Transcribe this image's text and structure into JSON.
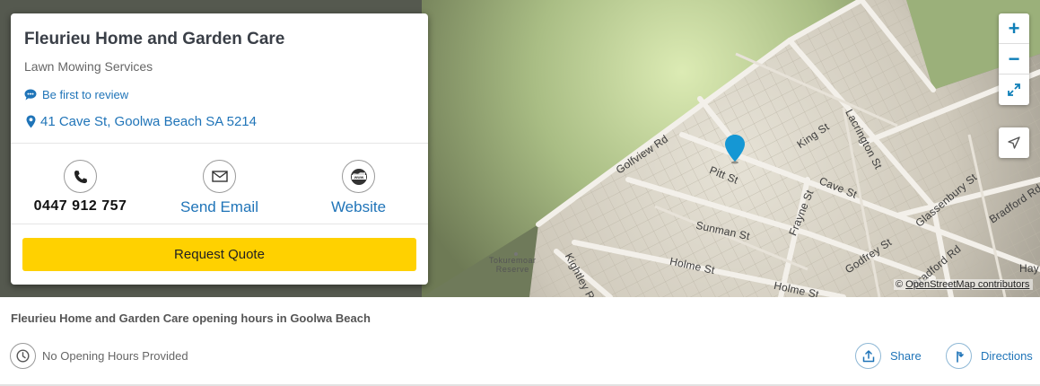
{
  "business": {
    "name": "Fleurieu Home and Garden Care",
    "category": "Lawn Mowing Services",
    "review_link": "Be first to review",
    "address": "41 Cave St, Goolwa Beach SA 5214"
  },
  "actions": {
    "phone": "0447 912 757",
    "email": "Send Email",
    "website": "Website",
    "website_icon_text": "www",
    "quote": "Request Quote"
  },
  "map": {
    "streets": [
      "Golfview Rd",
      "Pitt St",
      "King St",
      "Lacrington St",
      "Cave St",
      "Frayne St",
      "Sunman St",
      "Glassenbury St",
      "Bradford Rd",
      "Godfrey St",
      "Holme St",
      "Holme St",
      "Kightley Rd",
      "Bradford Rd",
      "Hay"
    ],
    "reserve": [
      "Tokuremoar",
      "Reserve"
    ],
    "attribution_prefix": "©",
    "attribution_link": "OpenStreetMap contributors",
    "zoom_in": "+",
    "zoom_out": "−",
    "colors": {
      "grass": "#a8bd7f",
      "urban": "#cfc9bb",
      "road": "#f3f0ea",
      "pin": "#1597d4"
    }
  },
  "hours": {
    "title": "Fleurieu Home and Garden Care opening hours in Goolwa Beach",
    "status": "No Opening Hours Provided"
  },
  "footer_actions": {
    "share": "Share",
    "directions": "Directions"
  }
}
